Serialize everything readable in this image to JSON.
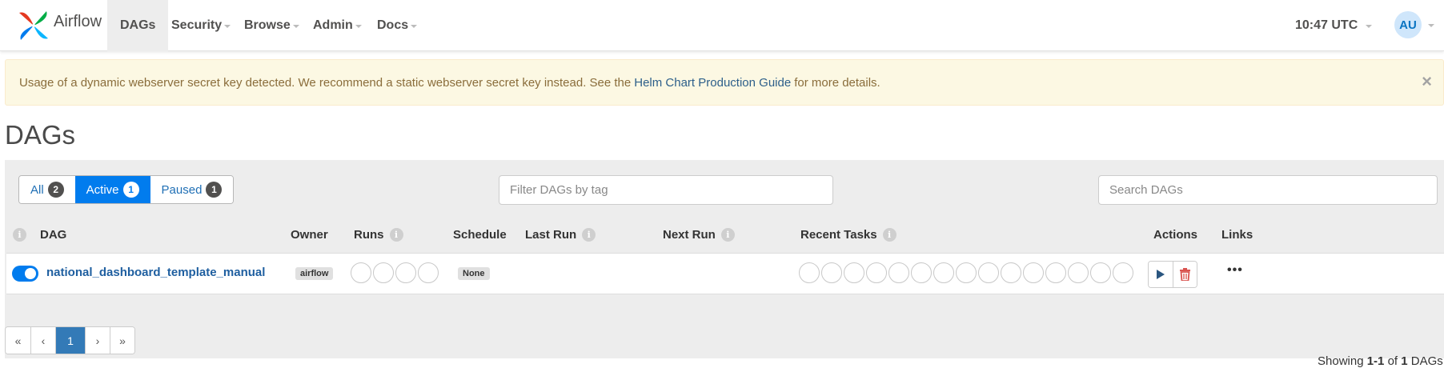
{
  "navbar": {
    "brand": "Airflow",
    "items": [
      {
        "label": "DAGs",
        "active": true,
        "dropdown": false
      },
      {
        "label": "Security",
        "dropdown": true
      },
      {
        "label": "Browse",
        "dropdown": true
      },
      {
        "label": "Admin",
        "dropdown": true
      },
      {
        "label": "Docs",
        "dropdown": true
      }
    ],
    "time": "10:47 UTC",
    "user_initials": "AU"
  },
  "alert": {
    "text_before": "Usage of a dynamic webserver secret key detected. We recommend a static webserver secret key instead. See the",
    "link_text": "Helm Chart Production Guide",
    "text_after": "for more details.",
    "close": "×"
  },
  "page": {
    "title": "DAGs"
  },
  "filters": {
    "tabs": [
      {
        "label": "All",
        "count": "2"
      },
      {
        "label": "Active",
        "count": "1",
        "active": true
      },
      {
        "label": "Paused",
        "count": "1"
      }
    ],
    "tag_placeholder": "Filter DAGs by tag",
    "search_placeholder": "Search DAGs"
  },
  "table": {
    "info_glyph": "i",
    "headers": {
      "dag": "DAG",
      "owner": "Owner",
      "runs": "Runs",
      "schedule": "Schedule",
      "last_run": "Last Run",
      "next_run": "Next Run",
      "recent_tasks": "Recent Tasks",
      "actions": "Actions",
      "links": "Links"
    },
    "rows": [
      {
        "enabled": true,
        "dag_id": "national_dashboard_template_manual",
        "owner": "airflow",
        "schedule": "None",
        "last_run": "",
        "next_run": "",
        "runs_circles": 4,
        "recent_task_circles": 15,
        "links_more": "•••"
      }
    ]
  },
  "pagination": {
    "first": "«",
    "prev": "‹",
    "current": "1",
    "next": "›",
    "last": "»"
  },
  "summary": {
    "prefix": "Showing",
    "range": "1-1",
    "of": "of",
    "total": "1",
    "suffix": "DAGs"
  },
  "colors": {
    "accent": "#017cee",
    "link": "#1f5fa0",
    "alert_bg": "#fcf8e3",
    "delete": "#d9534f"
  },
  "icons": {
    "brand": "airflow-pinwheel-icon",
    "trigger": "play-icon",
    "delete": "trash-icon",
    "info": "info-icon",
    "close": "close-icon"
  }
}
